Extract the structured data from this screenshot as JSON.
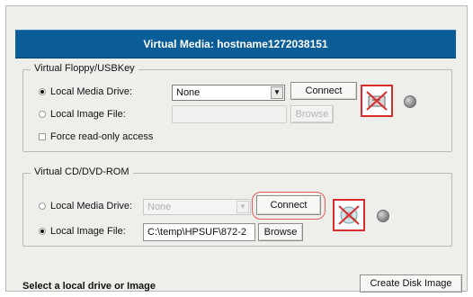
{
  "dialog": {
    "title": "Virtual Media: hostname1272038151"
  },
  "floppy": {
    "group_title": "Virtual Floppy/USBKey",
    "local_media_drive_label": "Local Media Drive:",
    "local_media_drive_value": "None",
    "connect_label": "Connect",
    "local_image_file_label": "Local Image File:",
    "browse_label": "Browse",
    "force_readonly_label": "Force read-only access"
  },
  "cdrom": {
    "group_title": "Virtual CD/DVD-ROM",
    "local_media_drive_label": "Local Media Drive:",
    "local_media_drive_value": "None",
    "connect_label": "Connect",
    "local_image_file_label": "Local Image File:",
    "local_image_file_value": "C:\\temp\\HPSUF\\872-2",
    "browse_label": "Browse"
  },
  "footer": {
    "status_text": "Select a local drive or Image",
    "create_disk_image_label": "Create Disk Image"
  },
  "colors": {
    "header_blue": "#0a5d97",
    "status_red": "#d92d2d",
    "highlight_red": "#e45b5b"
  },
  "icons": {
    "floppy_disconnected": "crossed-disk-drive-icon",
    "cdrom_disconnected": "crossed-optical-drive-icon",
    "status_led": "status-led-icon"
  }
}
